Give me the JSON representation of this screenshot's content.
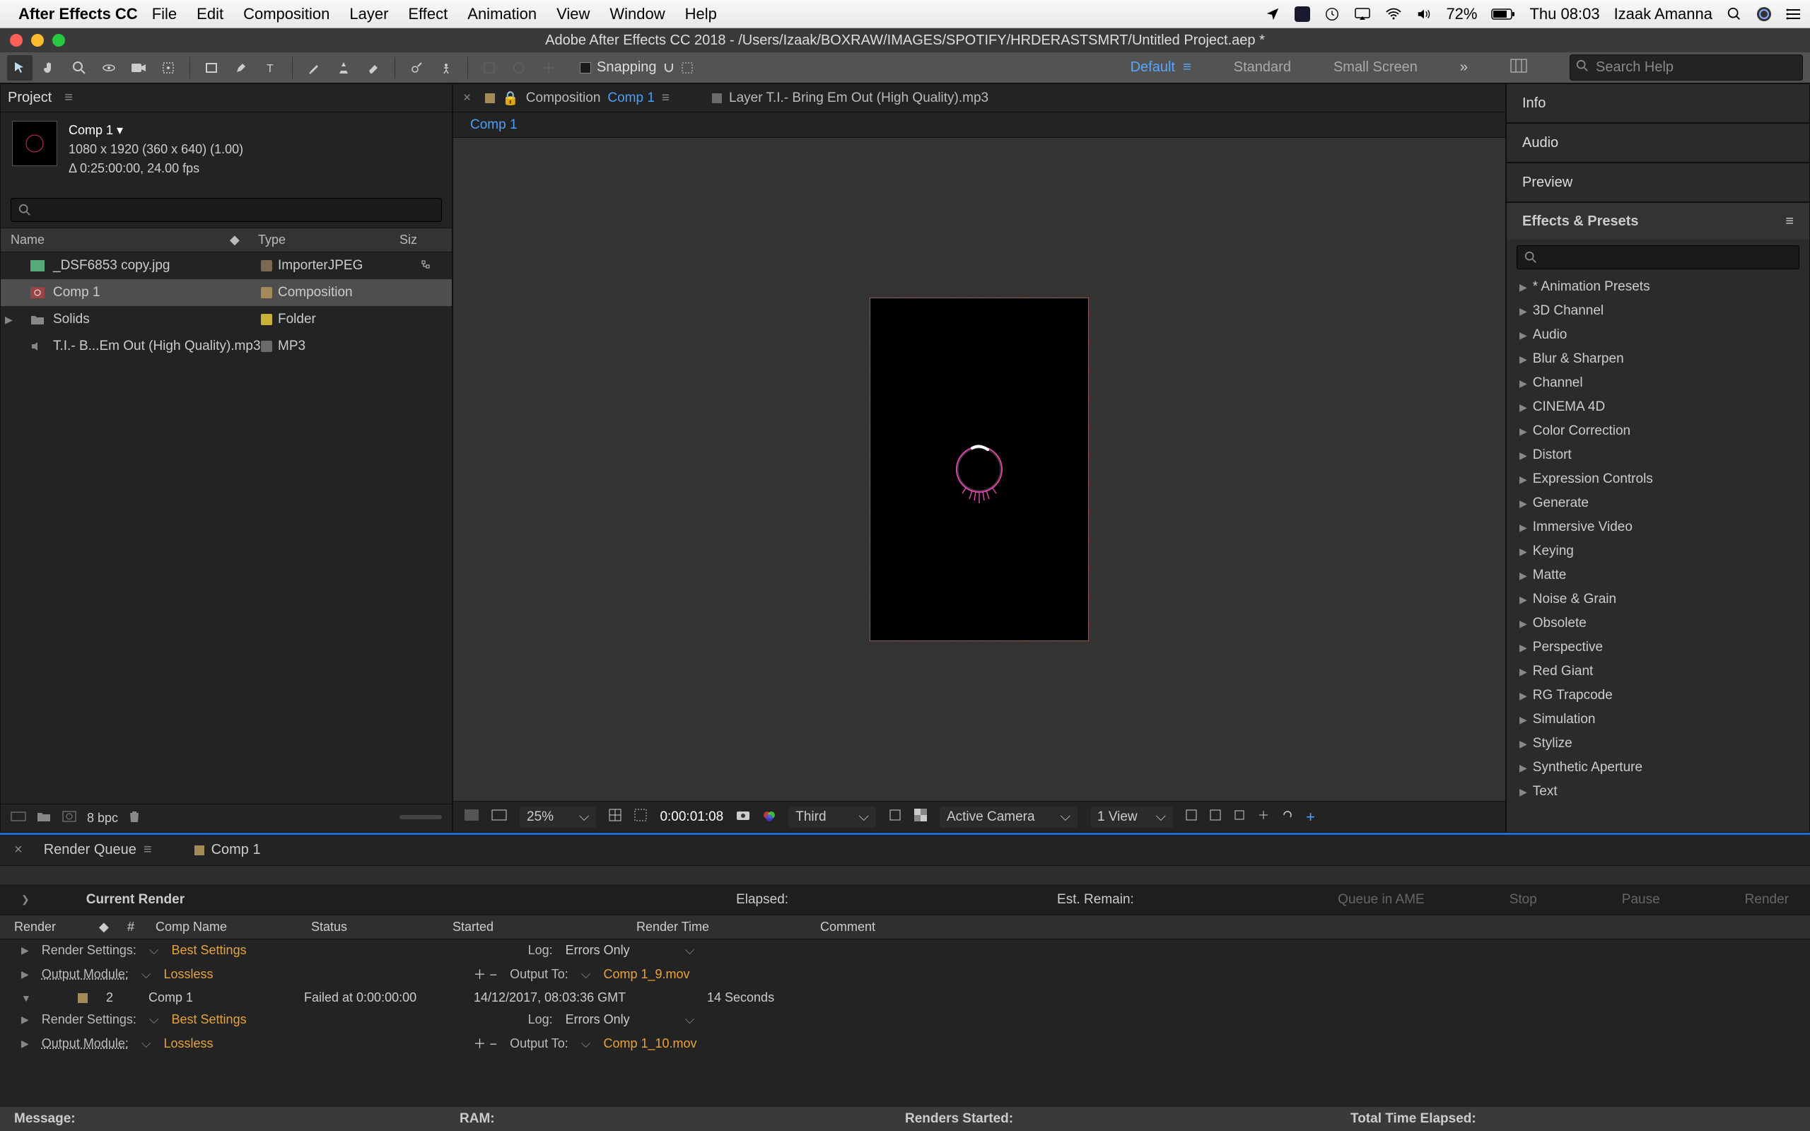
{
  "menubar": {
    "app_name": "After Effects CC",
    "items": [
      "File",
      "Edit",
      "Composition",
      "Layer",
      "Effect",
      "Animation",
      "View",
      "Window",
      "Help"
    ],
    "battery_pct": "72%",
    "clock": "Thu 08:03",
    "user": "Izaak Amanna"
  },
  "window_title": "Adobe After Effects CC 2018 - /Users/Izaak/BOXRAW/IMAGES/SPOTIFY/HRDERASTSMRT/Untitled Project.aep *",
  "toolbar": {
    "snapping_label": "Snapping",
    "workspaces": {
      "default": "Default",
      "standard": "Standard",
      "small": "Small Screen"
    },
    "search_placeholder": "Search Help"
  },
  "project_panel": {
    "tab": "Project",
    "comp_name": "Comp 1 ▾",
    "dims": "1080 x 1920  (360 x 640) (1.00)",
    "duration": "Δ 0:25:00:00, 24.00 fps",
    "headers": {
      "name": "Name",
      "type": "Type",
      "size": "Siz"
    },
    "rows": [
      {
        "name": "_DSF6853 copy.jpg",
        "type": "ImporterJPEG",
        "swatch": "#7a6a52",
        "icon": "image"
      },
      {
        "name": "Comp 1",
        "type": "Composition",
        "swatch": "#a38a56",
        "icon": "comp",
        "selected": true
      },
      {
        "name": "Solids",
        "type": "Folder",
        "swatch": "#c9b037",
        "icon": "folder",
        "expander": true
      },
      {
        "name": "T.I.- B...Em Out (High Quality).mp3",
        "type": "MP3",
        "swatch": "#6b6b6b",
        "icon": "audio"
      }
    ],
    "footer_bpc": "8 bpc"
  },
  "viewer": {
    "tab_prefix": "Composition",
    "tab_link": "Comp 1",
    "layer_tab": "Layer T.I.- Bring Em Out (High Quality).mp3",
    "crumb": "Comp 1",
    "footer": {
      "zoom": "25%",
      "timecode": "0:00:01:08",
      "resolution": "Third",
      "camera": "Active Camera",
      "views": "1 View"
    }
  },
  "right_panels": {
    "info": "Info",
    "audio": "Audio",
    "preview": "Preview",
    "effects_title": "Effects & Presets",
    "effects": [
      "* Animation Presets",
      "3D Channel",
      "Audio",
      "Blur & Sharpen",
      "Channel",
      "CINEMA 4D",
      "Color Correction",
      "Distort",
      "Expression Controls",
      "Generate",
      "Immersive Video",
      "Keying",
      "Matte",
      "Noise & Grain",
      "Obsolete",
      "Perspective",
      "Red Giant",
      "RG Trapcode",
      "Simulation",
      "Stylize",
      "Synthetic Aperture",
      "Text"
    ]
  },
  "render_queue": {
    "tab": "Render Queue",
    "comp_tab": "Comp 1",
    "current_render": "Current Render",
    "elapsed": "Elapsed:",
    "est_remain": "Est. Remain:",
    "btn_ame": "Queue in AME",
    "btn_stop": "Stop",
    "btn_pause": "Pause",
    "btn_render": "Render",
    "headers": {
      "render": "Render",
      "hash": "#",
      "comp": "Comp Name",
      "status": "Status",
      "started": "Started",
      "rtime": "Render Time",
      "comment": "Comment"
    },
    "item1": {
      "rs_label": "Render Settings:",
      "rs_val": "Best Settings",
      "log_label": "Log:",
      "log_val": "Errors Only",
      "om_label": "Output Module:",
      "om_val": "Lossless",
      "ot_label": "Output To:",
      "ot_val": "Comp 1_9.mov"
    },
    "item2": {
      "num": "2",
      "comp": "Comp 1",
      "status": "Failed at 0:00:00:00",
      "started": "14/12/2017, 08:03:36 GMT",
      "rtime": "14 Seconds",
      "rs_label": "Render Settings:",
      "rs_val": "Best Settings",
      "log_label": "Log:",
      "log_val": "Errors Only",
      "om_label": "Output Module:",
      "om_val": "Lossless",
      "ot_label": "Output To:",
      "ot_val": "Comp 1_10.mov"
    },
    "msg": "Message:",
    "ram": "RAM:",
    "renders_started": "Renders Started:",
    "total_time": "Total Time Elapsed:"
  }
}
